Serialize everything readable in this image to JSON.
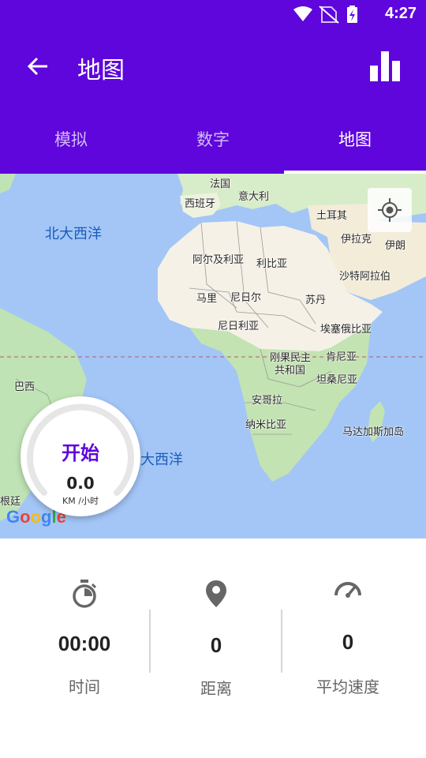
{
  "status_bar": {
    "time": "4:27",
    "icons": [
      "wifi-icon",
      "no-sim-icon",
      "battery-charging-icon"
    ]
  },
  "app_bar": {
    "title": "地图",
    "back_icon": "arrow-back-icon",
    "action_icon": "bar-chart-icon"
  },
  "tabs": [
    {
      "label": "模拟",
      "active": false
    },
    {
      "label": "数字",
      "active": false
    },
    {
      "label": "地图",
      "active": true
    }
  ],
  "map": {
    "oceans": {
      "north_atlantic": "北大西洋",
      "atlantic": "大西洋"
    },
    "countries": {
      "france": "法国",
      "spain": "西班牙",
      "italy": "意大利",
      "turkey": "土耳其",
      "iraq": "伊拉克",
      "iran": "伊朗",
      "algeria": "阿尔及利亚",
      "libya": "利比亚",
      "saudi": "沙特阿拉伯",
      "mali": "马里",
      "niger": "尼日尔",
      "sudan": "苏丹",
      "nigeria": "尼日利亚",
      "ethiopia": "埃塞俄比亚",
      "drc_line1": "刚果民主",
      "drc_line2": "共和国",
      "kenya": "肯尼亚",
      "tanzania": "坦桑尼亚",
      "angola": "安哥拉",
      "namibia": "纳米比亚",
      "madagascar": "马达加斯加岛",
      "brazil": "巴西",
      "argentina": "根廷"
    },
    "attribution": "Google",
    "locate_icon": "my-location-icon"
  },
  "speedometer": {
    "start_label": "开始",
    "speed": "0.0",
    "unit": "KM /小时",
    "progress": 0
  },
  "stats": [
    {
      "icon": "stopwatch-icon",
      "value": "00:00",
      "label": "时间"
    },
    {
      "icon": "location-pin-icon",
      "value": "0",
      "label": "距离"
    },
    {
      "icon": "speed-gauge-icon",
      "value": "0",
      "label": "平均速度"
    }
  ],
  "colors": {
    "primary": "#5e06dc",
    "ocean": "#a3c6f7",
    "land_desert": "#f5f1e7",
    "land_green": "#bfe3b4"
  }
}
